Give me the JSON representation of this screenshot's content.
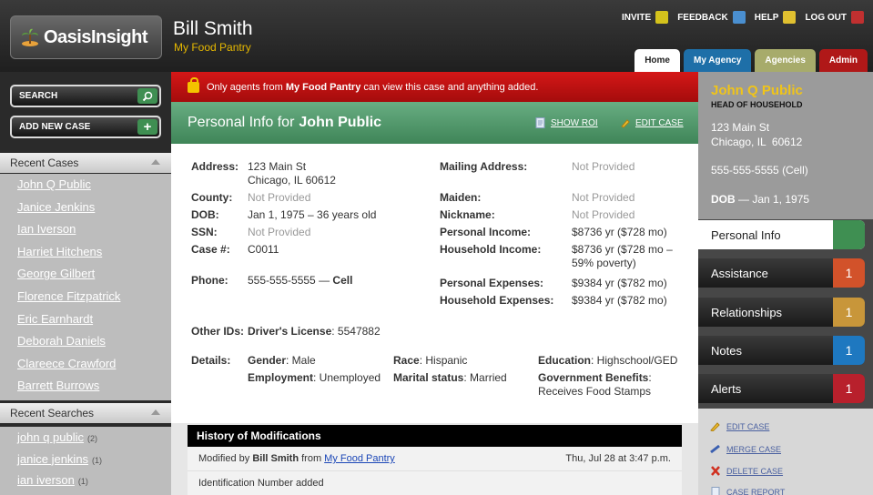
{
  "brand": {
    "logo_text": "OasisInsight"
  },
  "user": {
    "name": "Bill Smith",
    "org": "My Food Pantry"
  },
  "toplinks": [
    {
      "label": "INVITE",
      "icon": "person-icon",
      "color": "#d4c21c"
    },
    {
      "label": "FEEDBACK",
      "icon": "feedback-icon",
      "color": "#4a8fd0"
    },
    {
      "label": "HELP",
      "icon": "help-icon",
      "color": "#e0c030"
    },
    {
      "label": "LOG OUT",
      "icon": "logout-icon",
      "color": "#c03030"
    }
  ],
  "tabs": [
    {
      "label": "Home"
    },
    {
      "label": "My Agency"
    },
    {
      "label": "Agencies"
    },
    {
      "label": "Admin"
    }
  ],
  "left": {
    "search_label": "SEARCH",
    "add_case_label": "ADD NEW CASE",
    "recent_cases_title": "Recent Cases",
    "recent_cases": [
      "John Q Public",
      "Janice Jenkins",
      "Ian Iverson",
      "Harriet Hitchens",
      "George Gilbert",
      "Florence Fitzpatrick",
      "Eric Earnhardt",
      "Deborah Daniels",
      "Clareece Crawford",
      "Barrett Burrows"
    ],
    "recent_searches_title": "Recent Searches",
    "recent_searches": [
      {
        "text": "john q public",
        "count": "(2)"
      },
      {
        "text": "janice jenkins",
        "count": "(1)"
      },
      {
        "text": "ian iverson",
        "count": "(1)"
      }
    ]
  },
  "alert": {
    "prefix": "Only agents from ",
    "org": "My Food Pantry",
    "suffix": " can view this case and anything added."
  },
  "panel": {
    "title_prefix": "Personal Info for",
    "title_name": "John Public",
    "show_roi": "SHOW ROI",
    "edit_case": "EDIT CASE"
  },
  "info": {
    "address_label": "Address:",
    "address_line1": "123 Main St",
    "address_line2": "Chicago, IL 60612",
    "county_label": "County:",
    "county": "Not Provided",
    "dob_label": "DOB:",
    "dob": "Jan 1, 1975 – 36 years old",
    "ssn_label": "SSN:",
    "ssn": "Not Provided",
    "case_label": "Case #:",
    "case": "C0011",
    "phone_label": "Phone:",
    "phone": "555-555-5555 — ",
    "phone_type": "Cell",
    "mailing_label": "Mailing Address:",
    "mailing": "Not Provided",
    "maiden_label": "Maiden:",
    "maiden": "Not Provided",
    "nickname_label": "Nickname:",
    "nickname": "Not Provided",
    "pincome_label": "Personal Income:",
    "pincome": "$8736 yr ($728 mo)",
    "hincome_label": "Household Income:",
    "hincome_line1": "$8736 yr ($728 mo –",
    "hincome_line2": "59% poverty)",
    "pexp_label": "Personal Expenses:",
    "pexp": "$9384 yr ($782 mo)",
    "hexp_label": "Household Expenses:",
    "hexp": "$9384 yr ($782 mo)",
    "otherids_label": "Other IDs:",
    "dl_label": "Driver's License",
    "dl": ": 5547882",
    "details_label": "Details:",
    "gender_label": "Gender",
    "gender": ": Male",
    "employment_label": "Employment",
    "employment": ": Unemployed",
    "race_label": "Race",
    "race": ": Hispanic",
    "marital_label": "Marital status",
    "marital": ": Married",
    "education_label": "Education",
    "education": ": Highschool/GED",
    "benefits_label": "Government Benefits",
    "benefits_colon": ":",
    "benefits": "Receives Food Stamps"
  },
  "history": {
    "title": "History of Modifications",
    "modified_prefix": "Modified by ",
    "modified_by": "Bill Smith",
    "from": " from ",
    "agency": "My Food Pantry",
    "date": "Thu, Jul 28 at 3:47 p.m.",
    "change": "Identification Number added"
  },
  "right": {
    "name": "John Q Public",
    "role": "HEAD OF HOUSEHOLD",
    "addr1": "123 Main St",
    "addr2": "Chicago, IL  60612",
    "phone": "555-555-5555 (Cell)",
    "dob_label": "DOB",
    "dob": " — Jan 1, 1975",
    "tabs": [
      {
        "label": "Personal Info",
        "badge": "",
        "color": "#3f8f52"
      },
      {
        "label": "Assistance",
        "badge": "1",
        "color": "#d2522a"
      },
      {
        "label": "Relationships",
        "badge": "1",
        "color": "#c8963a"
      },
      {
        "label": "Notes",
        "badge": "1",
        "color": "#1e78c0"
      },
      {
        "label": "Alerts",
        "badge": "1",
        "color": "#b8202c"
      }
    ],
    "actions": [
      "EDIT CASE",
      "MERGE CASE",
      "DELETE CASE",
      "CASE REPORT"
    ]
  }
}
